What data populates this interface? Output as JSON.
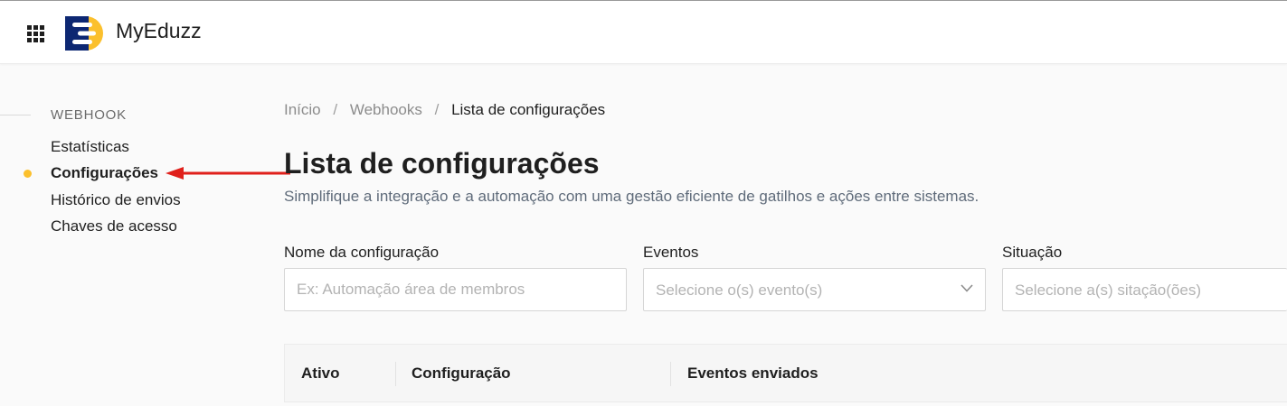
{
  "app": {
    "name": "MyEduzz"
  },
  "icons": {
    "apps": "apps-grid-icon",
    "logo": "eduzz-logo",
    "select_chevron": "chevron-down-icon"
  },
  "colors": {
    "accent": "#fbc02d",
    "logo_blue": "#0d2772",
    "logo_yellow": "#fbc02d",
    "annotation_arrow": "#e0201b"
  },
  "sidebar": {
    "section": "WEBHOOK",
    "items": [
      {
        "label": "Estatísticas",
        "active": false
      },
      {
        "label": "Configurações",
        "active": true
      },
      {
        "label": "Histórico de envios",
        "active": false
      },
      {
        "label": "Chaves de acesso",
        "active": false
      }
    ]
  },
  "breadcrumb": [
    "Início",
    "Webhooks",
    "Lista de configurações"
  ],
  "breadcrumb_separator": "/",
  "page": {
    "title": "Lista de configurações",
    "subtitle": "Simplifique a integração e a automação com uma gestão eficiente de gatilhos e ações entre sistemas."
  },
  "filters": {
    "name": {
      "label": "Nome da configuração",
      "placeholder": "Ex: Automação área de membros",
      "value": ""
    },
    "events": {
      "label": "Eventos",
      "placeholder": "Selecione o(s) evento(s)"
    },
    "status": {
      "label": "Situação",
      "placeholder": "Selecione a(s) sitação(ões)"
    }
  },
  "table": {
    "columns": [
      "Ativo",
      "Configuração",
      "Eventos enviados"
    ]
  }
}
